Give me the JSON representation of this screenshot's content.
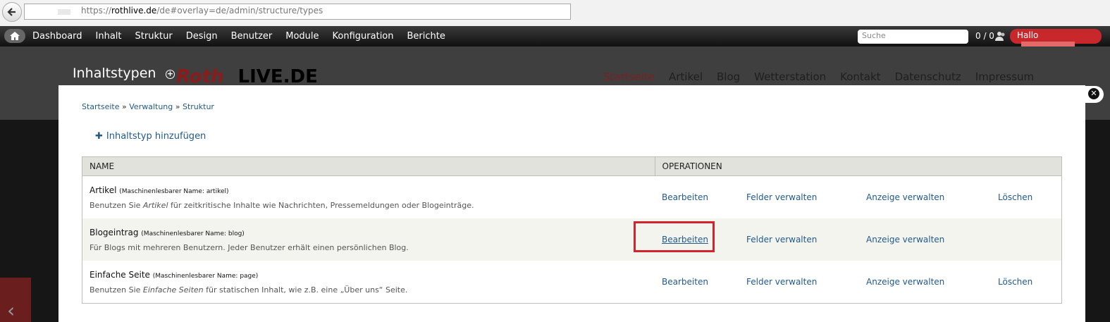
{
  "browser": {
    "url_scheme": "https://",
    "url_host": "rothlive.de",
    "url_path": "/de#overlay=de/admin/structure/types"
  },
  "toolbar": {
    "menu": [
      "Dashboard",
      "Inhalt",
      "Struktur",
      "Design",
      "Benutzer",
      "Module",
      "Konfiguration",
      "Berichte"
    ],
    "search_placeholder": "Suche",
    "counter": "0 / 0",
    "greeting": "Hallo"
  },
  "site": {
    "title": "Inhaltstypen",
    "logo_left": "Roth",
    "logo_right": "LIVE.DE",
    "nav": [
      "Startseite",
      "Artikel",
      "Blog",
      "Wetterstation",
      "Kontakt",
      "Datenschutz",
      "Impressum"
    ],
    "active_nav": "Startseite"
  },
  "overlay": {
    "breadcrumb": [
      "Startseite",
      "Verwaltung",
      "Struktur"
    ],
    "breadcrumb_sep": "»",
    "add_link": "Inhaltstyp hinzufügen",
    "table": {
      "headers": [
        "NAME",
        "OPERATIONEN"
      ],
      "rows": [
        {
          "name": "Artikel",
          "machine": "(Maschinenlesbarer Name: artikel)",
          "desc_pre": "Benutzen Sie ",
          "desc_em": "Artikel",
          "desc_post": " für zeitkritische Inhalte wie Nachrichten, Pressemeldungen oder Blogeinträge.",
          "ops": [
            "Bearbeiten",
            "Felder verwalten",
            "Anzeige verwalten",
            "Löschen"
          ]
        },
        {
          "name": "Blogeintrag",
          "machine": "(Maschinenlesbarer Name: blog)",
          "desc_pre": "Für Blogs mit mehreren Benutzern. Jeder Benutzer erhält einen persönlichen Blog.",
          "desc_em": "",
          "desc_post": "",
          "ops": [
            "Bearbeiten",
            "Felder verwalten",
            "Anzeige verwalten",
            ""
          ]
        },
        {
          "name": "Einfache Seite",
          "machine": "(Maschinenlesbarer Name: page)",
          "desc_pre": "Benutzen Sie ",
          "desc_em": "Einfache Seiten",
          "desc_post": " für statischen Inhalt, wie z.B. eine „Über uns“ Seite.",
          "ops": [
            "Bearbeiten",
            "Felder verwalten",
            "Anzeige verwalten",
            "Löschen"
          ]
        }
      ]
    }
  },
  "colors": {
    "link": "#225a8a",
    "highlight": "#d4232a",
    "hallo_bg": "#c8282b"
  }
}
